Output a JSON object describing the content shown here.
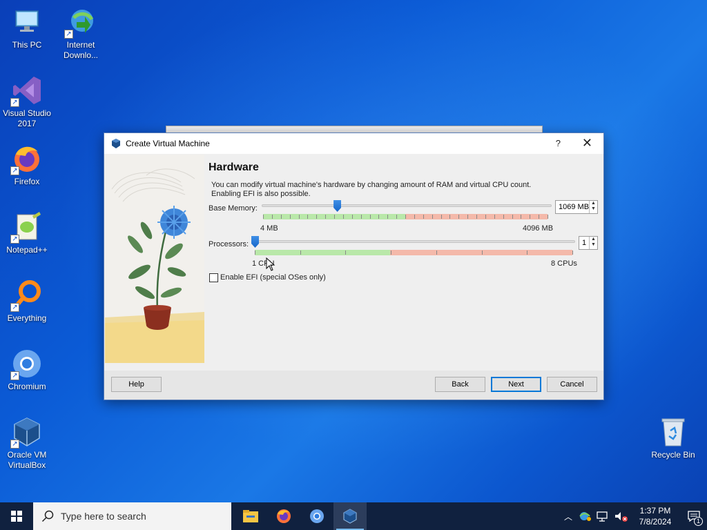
{
  "desktop": {
    "icons": [
      {
        "label": "This PC"
      },
      {
        "label": "Internet Downlo..."
      },
      {
        "label": "Visual Studio 2017"
      },
      {
        "label": "Firefox"
      },
      {
        "label": "Notepad++"
      },
      {
        "label": "Everything"
      },
      {
        "label": "Chromium"
      },
      {
        "label": "Oracle VM VirtualBox"
      },
      {
        "label": "Recycle Bin"
      }
    ]
  },
  "dialog": {
    "title": "Create Virtual Machine",
    "help_glyph": "?",
    "close_glyph": "✕",
    "heading": "Hardware",
    "description_line1": "You can modify virtual machine's hardware by changing amount of RAM and virtual CPU count.",
    "description_line2": "Enabling EFI is also possible.",
    "memory": {
      "label": "Base Memory:",
      "min_label": "4 MB",
      "max_label": "4096 MB",
      "value": "1069 MB",
      "level": 0.26
    },
    "processors": {
      "label": "Processors:",
      "min_label": "1 CPU",
      "max_label": "8 CPUs",
      "value": "1",
      "level": 0.0
    },
    "efi": {
      "label": "Enable EFI (special OSes only)",
      "checked": false
    },
    "buttons": {
      "help": "Help",
      "back": "Back",
      "next": "Next",
      "cancel": "Cancel"
    }
  },
  "taskbar": {
    "search_placeholder": "Type here to search",
    "apps": [
      "file-explorer",
      "firefox",
      "chromium",
      "virtualbox"
    ],
    "active_app": "virtualbox",
    "time": "1:37 PM",
    "date": "7/8/2024",
    "notification_count": "1"
  }
}
